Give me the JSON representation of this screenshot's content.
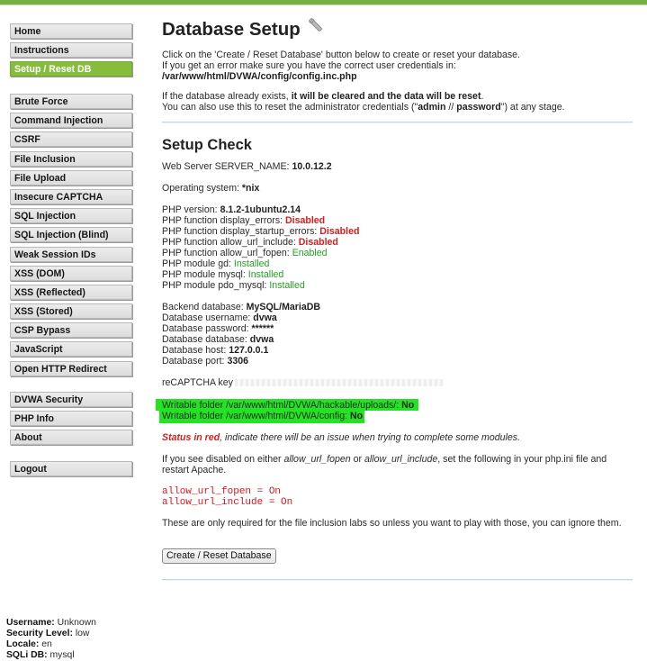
{
  "sidebar": {
    "group1": [
      {
        "label": "Home",
        "selected": false
      },
      {
        "label": "Instructions",
        "selected": false
      },
      {
        "label": "Setup / Reset DB",
        "selected": true
      }
    ],
    "group2": [
      {
        "label": "Brute Force"
      },
      {
        "label": "Command Injection"
      },
      {
        "label": "CSRF"
      },
      {
        "label": "File Inclusion"
      },
      {
        "label": "File Upload"
      },
      {
        "label": "Insecure CAPTCHA"
      },
      {
        "label": "SQL Injection"
      },
      {
        "label": "SQL Injection (Blind)"
      },
      {
        "label": "Weak Session IDs"
      },
      {
        "label": "XSS (DOM)"
      },
      {
        "label": "XSS (Reflected)"
      },
      {
        "label": "XSS (Stored)"
      },
      {
        "label": "CSP Bypass"
      },
      {
        "label": "JavaScript"
      },
      {
        "label": "Open HTTP Redirect"
      }
    ],
    "group3": [
      {
        "label": "DVWA Security"
      },
      {
        "label": "PHP Info"
      },
      {
        "label": "About"
      }
    ],
    "group4": [
      {
        "label": "Logout"
      }
    ]
  },
  "footer": {
    "username_label": "Username:",
    "username": "Unknown",
    "security_label": "Security Level:",
    "security": "low",
    "locale_label": "Locale:",
    "locale": "en",
    "sqlidb_label": "SQLi DB:",
    "sqlidb": "mysql"
  },
  "main": {
    "title": "Database Setup",
    "intro1": "Click on the 'Create / Reset Database' button below to create or reset your database.",
    "intro2": "If you get an error make sure you have the correct user credentials in: ",
    "config_path": "/var/www/html/DVWA/config/config.inc.php",
    "intro3": "If the database already exists, ",
    "intro3_bold": "it will be cleared and the data will be reset",
    "intro3_end": ".",
    "intro4a": "You can also use this to reset the administrator credentials (\"",
    "admin": "admin",
    "slashes": " // ",
    "password": "password",
    "intro4b": "\") at any stage.",
    "check_title": "Setup Check",
    "server_label": "Web Server SERVER_NAME: ",
    "server": "10.0.12.2",
    "os_label": "Operating system: ",
    "os": "*nix",
    "php_version_label": "PHP version: ",
    "php_version": "8.1.2-1ubuntu2.14",
    "display_errors_label": "PHP function display_errors: ",
    "display_errors": "Disabled",
    "display_startup_label": "PHP function display_startup_errors: ",
    "display_startup": "Disabled",
    "allow_include_label": "PHP function allow_url_include: ",
    "allow_include": "Disabled",
    "allow_fopen_label": "PHP function allow_url_fopen: ",
    "allow_fopen": "Enabled",
    "gd_label": "PHP module gd: ",
    "gd": "Installed",
    "mysql_label": "PHP module mysql: ",
    "mysql": "Installed",
    "pdo_label": "PHP module pdo_mysql: ",
    "pdo": "Installed",
    "backend_label": "Backend database: ",
    "backend": "MySQL/MariaDB",
    "db_user_label": "Database username: ",
    "db_user": "dvwa",
    "db_pass_label": "Database password: ",
    "db_pass": "******",
    "db_name_label": "Database database: ",
    "db_name": "dvwa",
    "db_host_label": "Database host: ",
    "db_host": "127.0.0.1",
    "db_port_label": "Database port: ",
    "db_port": "3306",
    "recaptcha_label": "reCAPTCHA key",
    "writable1_label": "Writable folder /var/www/html/DVWA/hackable/uploads/: ",
    "writable1": "No",
    "writable2_label": "Writable folder /var/www/html/DVWA/config: ",
    "writable2": "No",
    "status_red": "Status in red",
    "status_rest": ", indicate there will be an issue when trying to complete some modules.",
    "disabled_a": "If you see disabled on either ",
    "fopen_it": "allow_url_fopen",
    "or": " or ",
    "include_it": "allow_url_include",
    "disabled_b": ", set the following in your php.ini file and restart Apache.",
    "code1": "allow_url_fopen = On",
    "code2": "allow_url_include = On",
    "only_required": "These are only required for the file inclusion labs so unless you want to play with those, you can ignore them.",
    "button": "Create / Reset Database"
  },
  "colors": {
    "accent": "#74b043",
    "selected": "#86bd3c",
    "error": "#d21f1f",
    "ok": "#25a025",
    "highlight": "#22e422"
  },
  "icons": {
    "title_icon": "wrench-icon"
  }
}
